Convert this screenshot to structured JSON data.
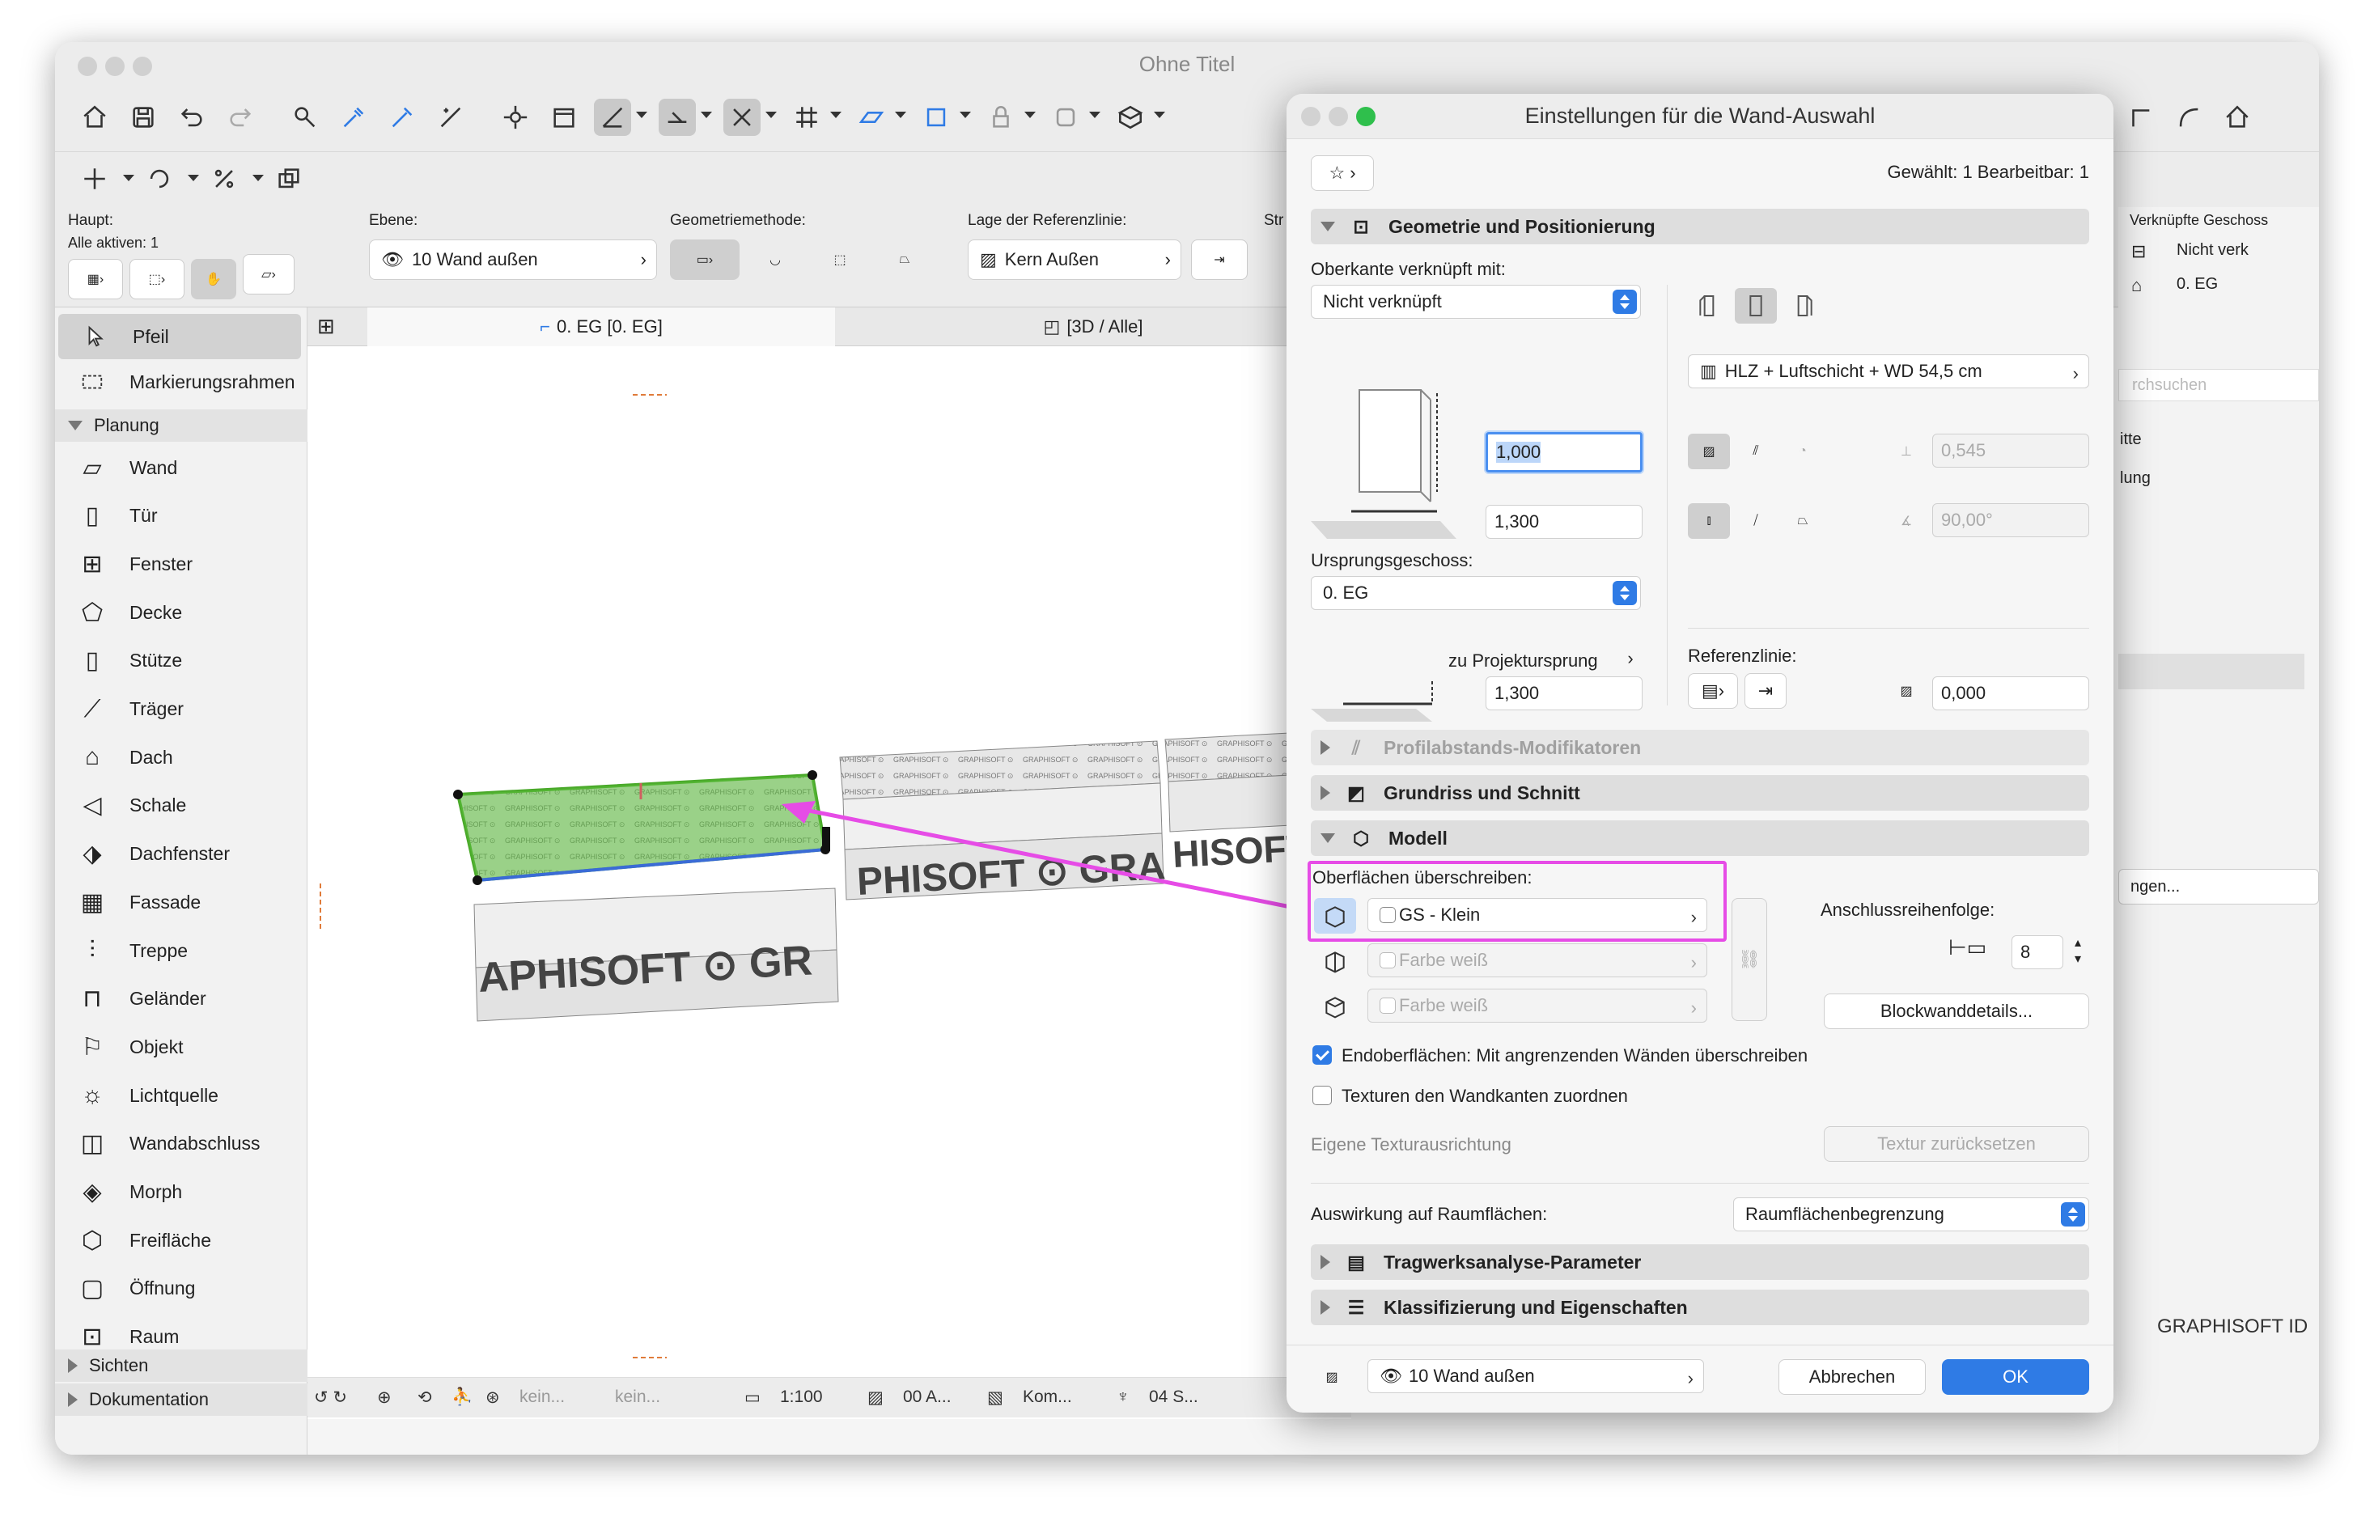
{
  "main_window": {
    "title": "Ohne Titel"
  },
  "infobox": {
    "haupt_label": "Haupt:",
    "alle_aktiven": "Alle aktiven: 1",
    "ebene_label": "Ebene:",
    "ebene_value": "10 Wand außen",
    "geometrie_label": "Geometriemethode:",
    "referenz_label": "Lage der Referenzlinie:",
    "referenz_value": "Kern Außen",
    "str_label": "Str"
  },
  "toolbox": {
    "items_top": [
      "Pfeil",
      "Markierungsrahmen"
    ],
    "group_planung": "Planung",
    "planung_items": [
      "Wand",
      "Tür",
      "Fenster",
      "Decke",
      "Stütze",
      "Träger",
      "Dach",
      "Schale",
      "Dachfenster",
      "Fassade",
      "Treppe",
      "Geländer",
      "Objekt",
      "Lichtquelle",
      "Wandabschluss",
      "Morph",
      "Freifläche",
      "Öffnung",
      "Raum"
    ],
    "group_sichten": "Sichten",
    "group_dokumentation": "Dokumentation"
  },
  "tabs": {
    "floorplan": "0. EG [0. EG]",
    "view3d": "[3D / Alle]"
  },
  "statusbar": {
    "kein1": "kein...",
    "kein2": "kein...",
    "scale": "1:100",
    "layer": "00 A...",
    "kom": "Kom...",
    "s04": "04 S..."
  },
  "rightpanel": {
    "verknuepfte": "Verknüpfte Geschoss",
    "nicht_verk": "Nicht verk",
    "eg": "0. EG",
    "search": "rchsuchen",
    "itte": "itte",
    "lung": "lung",
    "ngen": "ngen...",
    "brand": "GRAPHISOFT ID"
  },
  "dialog": {
    "title": "Einstellungen für die Wand-Auswahl",
    "selected": "Gewählt: 1 Bearbeitbar: 1",
    "sec_geometrie": "Geometrie und Positionierung",
    "oberkante_label": "Oberkante verknüpft mit:",
    "oberkante_value": "Nicht verknüpft",
    "height_value": "1,000",
    "height2_value": "1,300",
    "ursprung_label": "Ursprungsgeschoss:",
    "ursprung_value": "0. EG",
    "projekt_label": "zu Projektursprung",
    "projekt_value": "1,300",
    "composite": "HLZ + Luftschicht + WD 54,5 cm",
    "thickness_value": "0,545",
    "angle_value": "90,00°",
    "referenzlinie_label": "Referenzlinie:",
    "offset_value": "0,000",
    "sec_profil": "Profilabstands-Modifikatoren",
    "sec_grundriss": "Grundriss und Schnitt",
    "sec_modell": "Modell",
    "ober_label": "Oberflächen überschreiben:",
    "surface1": "GS - Klein",
    "surface2": "Farbe weiß",
    "surface3": "Farbe weiß",
    "anschluss_label": "Anschlussreihenfolge:",
    "anschluss_value": "8",
    "blockwand_btn": "Blockwanddetails...",
    "endo_label": "Endoberflächen: Mit angrenzenden Wänden überschreiben",
    "texturen_label": "Texturen den Wandkanten zuordnen",
    "eigene_label": "Eigene Texturausrichtung",
    "textur_btn": "Textur zurücksetzen",
    "raum_label": "Auswirkung auf Raumflächen:",
    "raum_value": "Raumflächenbegrenzung",
    "sec_tragwerk": "Tragwerksanalyse-Parameter",
    "sec_klass": "Klassifizierung und Eigenschaften",
    "layer_value": "10 Wand außen",
    "cancel_btn": "Abbrechen",
    "ok_btn": "OK"
  },
  "colors": {
    "accent": "#2f7be5",
    "highlight_magenta": "#e64ce6",
    "selected_green": "#5bbf3a"
  }
}
